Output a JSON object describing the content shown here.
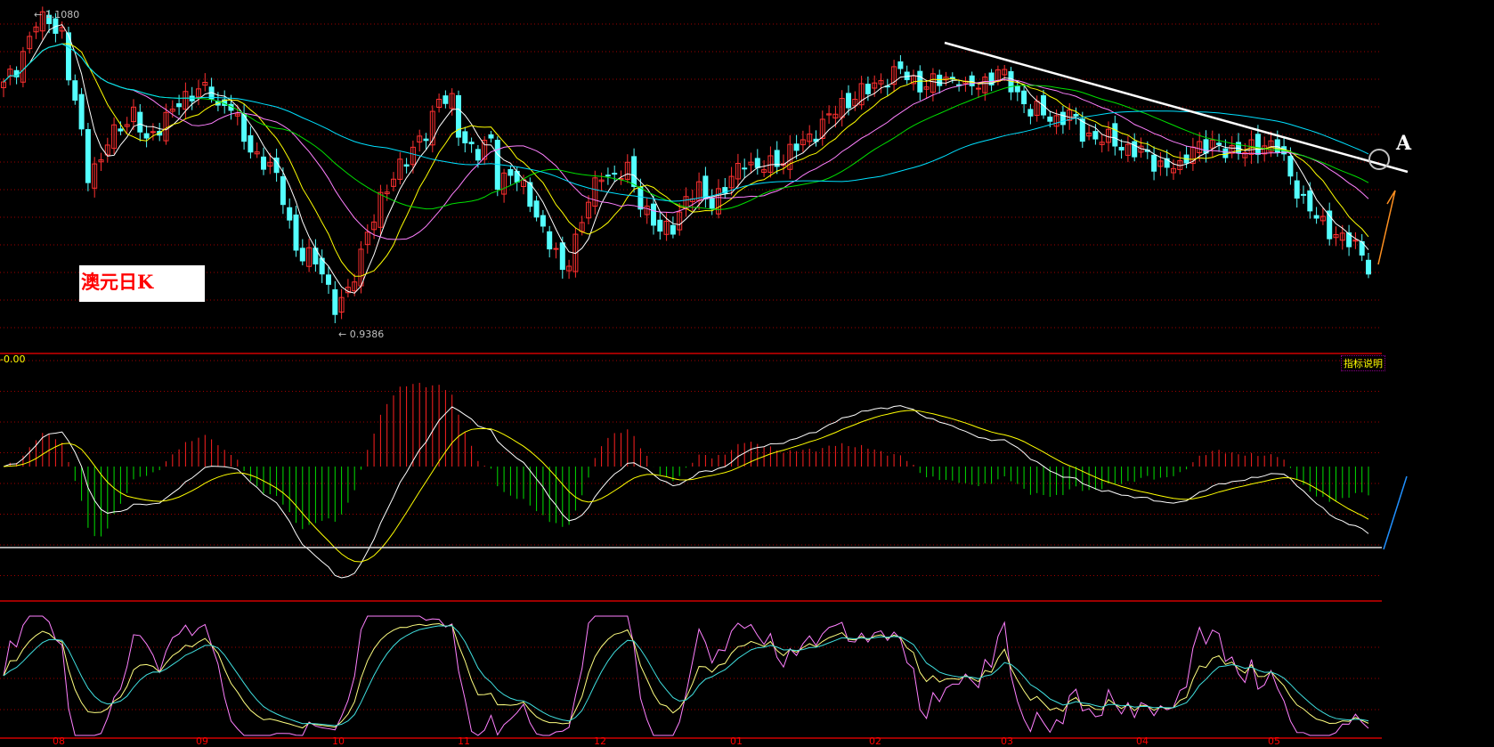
{
  "title": "澳元日K",
  "high_label": "1.1080",
  "low_label": "0.9386",
  "macd_label": "-0.00",
  "indicator_help": "指标说明",
  "annotation": "A",
  "months": [
    "08",
    "09",
    "10",
    "11",
    "12",
    "01",
    "02",
    "03",
    "04",
    "05"
  ],
  "colors": {
    "up": "#ff3030",
    "down": "#54ffff",
    "grid": "#a00000",
    "ma5": "#ffffff",
    "ma10": "#ffff00",
    "ma20": "#ff80ff",
    "ma30": "#00e000",
    "ma60": "#00e0ff"
  },
  "chart_data": {
    "type": "candlestick",
    "price_range": [
      0.9386,
      1.108
    ],
    "days": 211,
    "close_keypoints": [
      [
        0,
        1.0702
      ],
      [
        2,
        1.0803
      ],
      [
        5,
        1.1029
      ],
      [
        7,
        1.1054
      ],
      [
        9,
        1.0979
      ],
      [
        10,
        1.0752
      ],
      [
        12,
        1.045
      ],
      [
        13,
        1.0249
      ],
      [
        15,
        1.0299
      ],
      [
        16,
        1.04
      ],
      [
        18,
        1.05
      ],
      [
        20,
        1.0551
      ],
      [
        22,
        1.04
      ],
      [
        24,
        1.05
      ],
      [
        27,
        1.0601
      ],
      [
        30,
        1.0702
      ],
      [
        32,
        1.0652
      ],
      [
        33,
        1.0576
      ],
      [
        35,
        1.0626
      ],
      [
        37,
        1.04
      ],
      [
        39,
        1.0324
      ],
      [
        41,
        1.0299
      ],
      [
        43,
        1.0098
      ],
      [
        45,
        0.9846
      ],
      [
        47,
        0.9796
      ],
      [
        49,
        0.972
      ],
      [
        51,
        0.9544
      ],
      [
        53,
        0.9594
      ],
      [
        54,
        0.9695
      ],
      [
        56,
        0.9947
      ],
      [
        59,
        1.0148
      ],
      [
        61,
        1.0299
      ],
      [
        63,
        1.0349
      ],
      [
        65,
        1.045
      ],
      [
        67,
        1.0652
      ],
      [
        69,
        1.0601
      ],
      [
        70,
        1.045
      ],
      [
        73,
        1.0349
      ],
      [
        75,
        1.04
      ],
      [
        76,
        1.0199
      ],
      [
        78,
        1.0249
      ],
      [
        81,
        1.0098
      ],
      [
        83,
        0.9947
      ],
      [
        86,
        0.972
      ],
      [
        87,
        0.9796
      ],
      [
        89,
        0.9997
      ],
      [
        92,
        1.0249
      ],
      [
        94,
        1.0224
      ],
      [
        96,
        1.0249
      ],
      [
        98,
        1.0098
      ],
      [
        101,
        0.9921
      ],
      [
        103,
        0.9972
      ],
      [
        105,
        1.0098
      ],
      [
        107,
        1.0148
      ],
      [
        109,
        1.0098
      ],
      [
        111,
        1.0148
      ],
      [
        114,
        1.0324
      ],
      [
        116,
        1.0249
      ],
      [
        117,
        1.0274
      ],
      [
        120,
        1.0324
      ],
      [
        123,
        1.04
      ],
      [
        126,
        1.05
      ],
      [
        129,
        1.0601
      ],
      [
        131,
        1.0652
      ],
      [
        133,
        1.0677
      ],
      [
        136,
        1.0752
      ],
      [
        138,
        1.0777
      ],
      [
        140,
        1.0727
      ],
      [
        142,
        1.0702
      ],
      [
        144,
        1.0727
      ],
      [
        147,
        1.0752
      ],
      [
        148,
        1.0677
      ],
      [
        151,
        1.0727
      ],
      [
        153,
        1.0777
      ],
      [
        155,
        1.0702
      ],
      [
        158,
        1.0576
      ],
      [
        160,
        1.0551
      ],
      [
        162,
        1.0526
      ],
      [
        164,
        1.0551
      ],
      [
        166,
        1.045
      ],
      [
        169,
        1.0425
      ],
      [
        171,
        1.04
      ],
      [
        173,
        1.0375
      ],
      [
        175,
        1.0349
      ],
      [
        177,
        1.0299
      ],
      [
        180,
        1.0274
      ],
      [
        181,
        1.0249
      ],
      [
        183,
        1.04
      ],
      [
        185,
        1.0375
      ],
      [
        188,
        1.0375
      ],
      [
        191,
        1.0349
      ],
      [
        194,
        1.04
      ],
      [
        196,
        1.0375
      ],
      [
        198,
        1.0224
      ],
      [
        200,
        1.0098
      ],
      [
        202,
        0.9997
      ],
      [
        205,
        0.9921
      ],
      [
        207,
        0.9871
      ],
      [
        209,
        0.9821
      ],
      [
        210,
        0.9755
      ]
    ],
    "moving_averages": [
      5,
      10,
      20,
      30,
      60
    ],
    "indicators": [
      "MACD",
      "KDJ"
    ]
  }
}
